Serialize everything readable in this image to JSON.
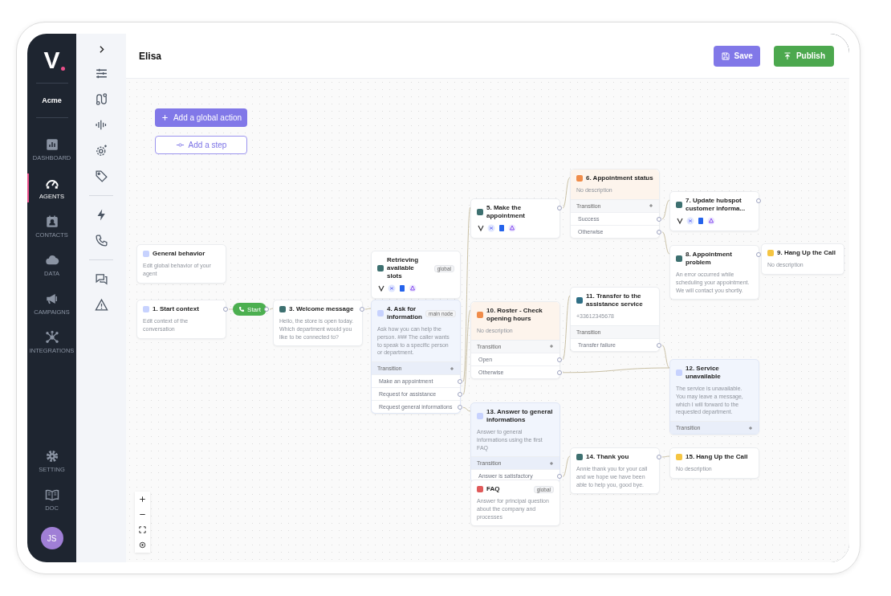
{
  "app": {
    "logo": "V",
    "workspace": "Acme"
  },
  "nav": [
    {
      "label": "DASHBOARD",
      "selected": false
    },
    {
      "label": "AGENTS",
      "selected": true
    },
    {
      "label": "CONTACTS",
      "selected": false
    },
    {
      "label": "DATA",
      "selected": false
    },
    {
      "label": "CAMPAIGNS",
      "selected": false
    },
    {
      "label": "INTEGRATIONS",
      "selected": false
    }
  ],
  "nav_bottom": [
    {
      "label": "SETTING",
      "selected": false
    },
    {
      "label": "DOC",
      "selected": false
    }
  ],
  "user": {
    "initials": "JS"
  },
  "page": {
    "title": "Elisa"
  },
  "actions": [
    {
      "label": "Save"
    },
    {
      "label": "Publish"
    }
  ],
  "canvas_buttons": [
    {
      "label": "Add a global action",
      "kind": "primary"
    },
    {
      "label": "Add a step",
      "kind": "outline"
    }
  ],
  "start": {
    "label": "Start"
  },
  "nodes": [
    {
      "title": "General behavior",
      "kind": "info",
      "color": "#c7d2fe",
      "description": "Edit global behavior of your agent",
      "output_port": false
    },
    {
      "title": "1. Start context",
      "kind": "info",
      "color": "#c7d2fe",
      "description": "Edit context of the conversation",
      "output_port": true
    },
    {
      "title": "3. Welcome message",
      "kind": "info",
      "color": "#3d7070",
      "description": "Hello, the store is open today. Which department would you like to be connected to?",
      "output_port": true
    },
    {
      "title": "Retrieving available slots",
      "kind": "tools",
      "color": "#3d7070",
      "tag": "global",
      "output_port": false
    },
    {
      "title": "4. Ask for information",
      "kind": "focus",
      "color": "#c7d2fe",
      "tag": "main node",
      "description": "Ask how you can help the person. ### The caller wants to speak to a specific person or department.",
      "transition_header": "Transition",
      "can_add": true,
      "transitions": [
        "Make an appointment",
        "Request for assistance",
        "Request general informations"
      ],
      "output_port": false
    },
    {
      "title": "5. Make the appointment",
      "kind": "tools",
      "color": "#3d7070",
      "output_port": true
    },
    {
      "title": "6. Appointment status",
      "kind": "condition",
      "color": "#f08c4a",
      "description": "No description",
      "transition_header": "Transition",
      "can_add": true,
      "transitions": [
        "Success",
        "Otherwise"
      ],
      "output_port": false
    },
    {
      "title": "10. Roster - Check opening hours",
      "kind": "condition",
      "color": "#f08c4a",
      "description": "No description",
      "transition_header": "Transition",
      "can_add": true,
      "transitions": [
        "Open",
        "Otherwise"
      ],
      "output_port": false
    },
    {
      "title": "11. Transfer to the assistance service",
      "kind": "info",
      "color": "#2f6f86",
      "description": "+33612345678",
      "transition_header": "Transition",
      "can_add": false,
      "transitions": [
        "Transfer failure"
      ],
      "output_port": false
    },
    {
      "title": "7. Update hubspot customer informa...",
      "kind": "tools",
      "color": "#3d7070",
      "output_port": true
    },
    {
      "title": "8. Appointment problem",
      "kind": "info",
      "color": "#3d7070",
      "description": "An error occurred while scheduling your appointment. We will contact you shortly.",
      "output_port": true
    },
    {
      "title": "9. Hang Up the Call",
      "kind": "info",
      "color": "#f5c542",
      "description": "No description",
      "output_port": false
    },
    {
      "title": "12. Service unavailable",
      "kind": "focus",
      "color": "#c7d2fe",
      "description": "The service is unavailable. You may leave a message, which I will forward to the requested department.",
      "transition_header": "Transition",
      "can_add": true,
      "output_port": false
    },
    {
      "title": "13. Answer to general informations",
      "kind": "focus",
      "color": "#c7d2fe",
      "description": "Answer to general informations using the first FAQ",
      "transition_header": "Transition",
      "can_add": true,
      "transitions": [
        "Answer is satisfactory"
      ],
      "output_port": false
    },
    {
      "title": "FAQ",
      "kind": "info",
      "color": "#e05a5a",
      "tag": "global",
      "description": "Answer for principal question about the company and processes",
      "output_port": false
    },
    {
      "title": "14. Thank you",
      "kind": "info",
      "color": "#3d7070",
      "description": "Annie thank you for your call and we hope we have been able to help you, good bye.",
      "output_port": true
    },
    {
      "title": "15. Hang Up the Call",
      "kind": "info",
      "color": "#f5c542",
      "description": "No description",
      "output_port": false
    }
  ]
}
